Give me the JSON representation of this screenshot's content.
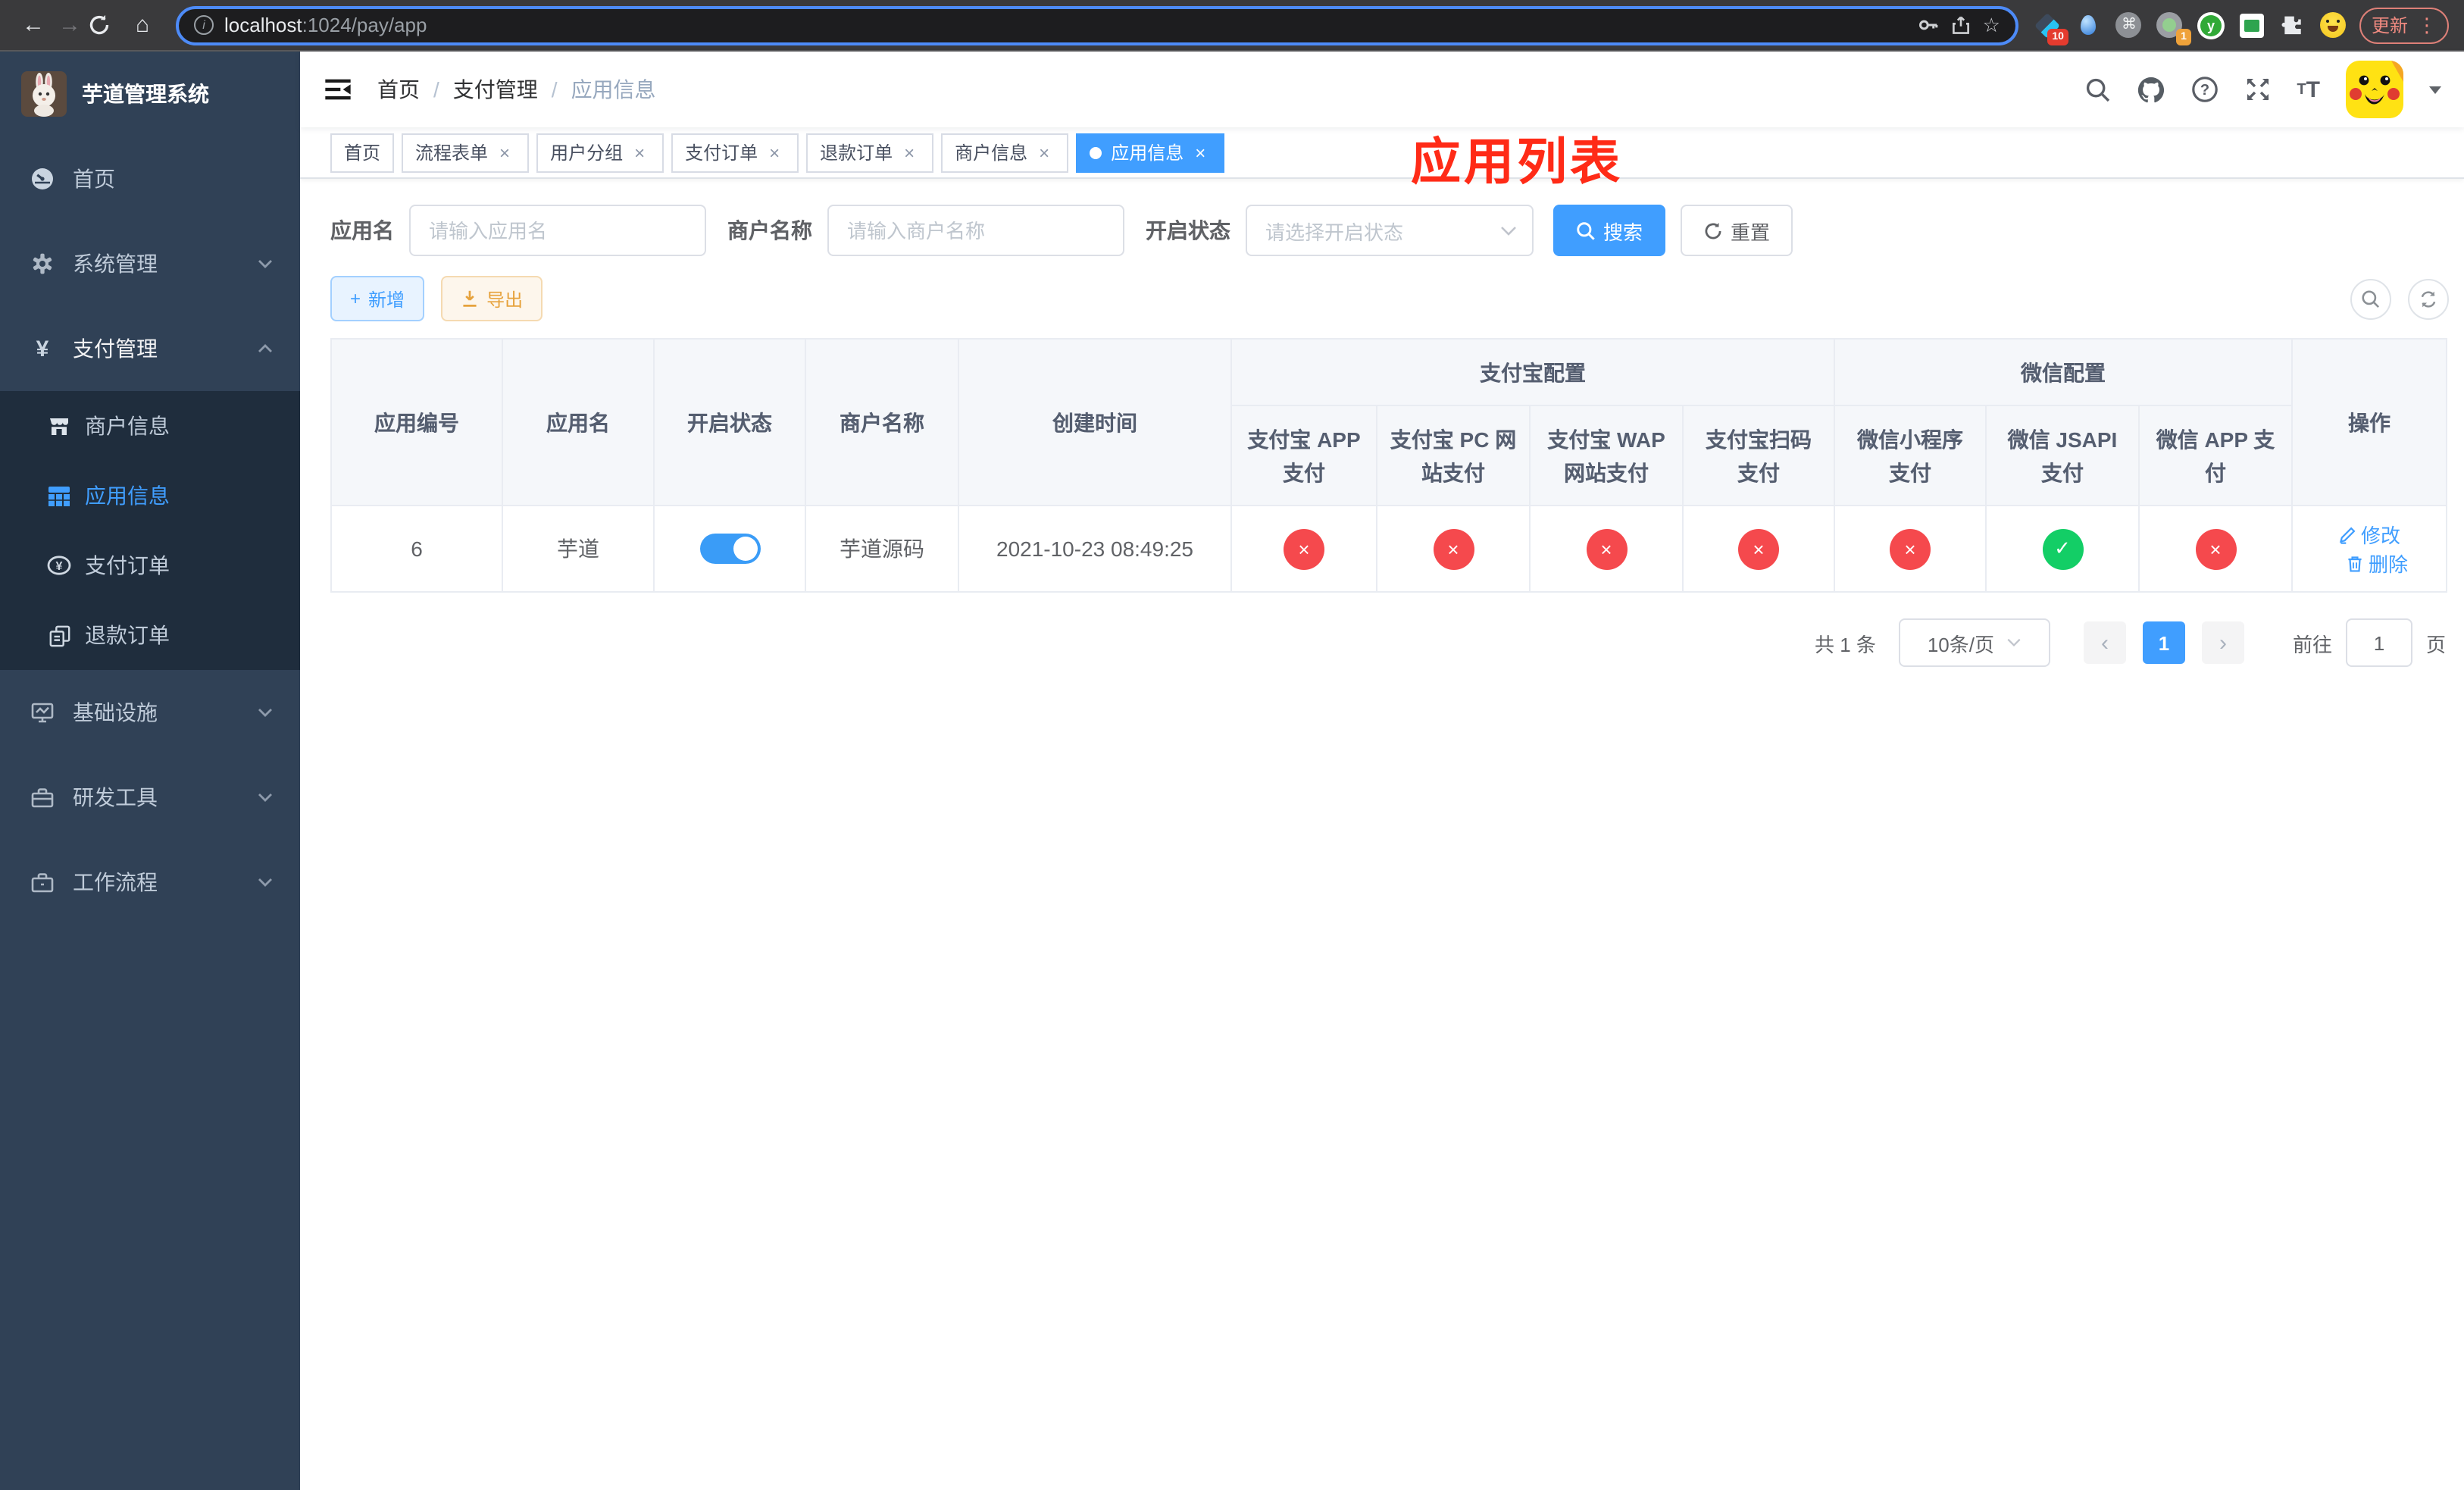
{
  "browser": {
    "url": {
      "host": "localhost",
      "rest": ":1024/pay/app"
    },
    "update_label": "更新",
    "badges": {
      "ext1": "10",
      "ext2": "1"
    }
  },
  "sidebar": {
    "title": "芋道管理系统",
    "menu": [
      {
        "label": "首页"
      },
      {
        "label": "系统管理"
      },
      {
        "label": "支付管理"
      },
      {
        "label": "基础设施"
      },
      {
        "label": "研发工具"
      },
      {
        "label": "工作流程"
      }
    ],
    "submenu": [
      {
        "label": "商户信息"
      },
      {
        "label": "应用信息"
      },
      {
        "label": "支付订单"
      },
      {
        "label": "退款订单"
      }
    ]
  },
  "navbar": {
    "breadcrumb": [
      "首页",
      "支付管理",
      "应用信息"
    ],
    "separator": "/"
  },
  "annotation": "应用列表",
  "tabs": [
    {
      "label": "首页"
    },
    {
      "label": "流程表单"
    },
    {
      "label": "用户分组"
    },
    {
      "label": "支付订单"
    },
    {
      "label": "退款订单"
    },
    {
      "label": "商户信息"
    },
    {
      "label": "应用信息"
    }
  ],
  "filters": {
    "app_name_label": "应用名",
    "app_name_placeholder": "请输入应用名",
    "merchant_label": "商户名称",
    "merchant_placeholder": "请输入商户名称",
    "status_label": "开启状态",
    "status_placeholder": "请选择开启状态",
    "search_label": "搜索",
    "reset_label": "重置"
  },
  "toolbar": {
    "add_label": "新增",
    "export_label": "导出"
  },
  "table": {
    "groups": {
      "alipay": "支付宝配置",
      "wechat": "微信配置"
    },
    "columns": [
      "应用编号",
      "应用名",
      "开启状态",
      "商户名称",
      "创建时间",
      "支付宝 APP 支付",
      "支付宝 PC 网站支付",
      "支付宝 WAP 网站支付",
      "支付宝扫码支付",
      "微信小程序支付",
      "微信 JSAPI 支付",
      "微信 APP 支付",
      "操作"
    ],
    "row": {
      "id": "6",
      "name": "芋道",
      "enabled": true,
      "merchant": "芋道源码",
      "created": "2021-10-23 08:49:25",
      "statuses": [
        "no",
        "no",
        "no",
        "no",
        "no",
        "yes",
        "no"
      ],
      "edit": "修改",
      "delete": "删除"
    }
  },
  "pagination": {
    "total": "共 1 条",
    "page_size": "10条/页",
    "page": "1",
    "goto": "前往",
    "goto_value": "1",
    "unit": "页"
  },
  "icons": {
    "back": "←",
    "forward": "→",
    "home": "⌂",
    "star": "☆",
    "dots": "⋮",
    "info": "i",
    "cmd": "⌘",
    "close": "×",
    "check": "✓",
    "cross": "×",
    "plus": "+",
    "yen": "¥",
    "question": "?",
    "prev": "‹",
    "next": "›",
    "tt_small": "T",
    "tt_big": "T",
    "y_ext": "y"
  },
  "colors": {
    "primary": "#409eff",
    "success": "#13ce66",
    "danger": "#f5494d",
    "warning": "#e6a23c",
    "sidebar_bg": "#304156",
    "submenu_bg": "#1f2d3d",
    "annotation": "#ff2b17"
  }
}
